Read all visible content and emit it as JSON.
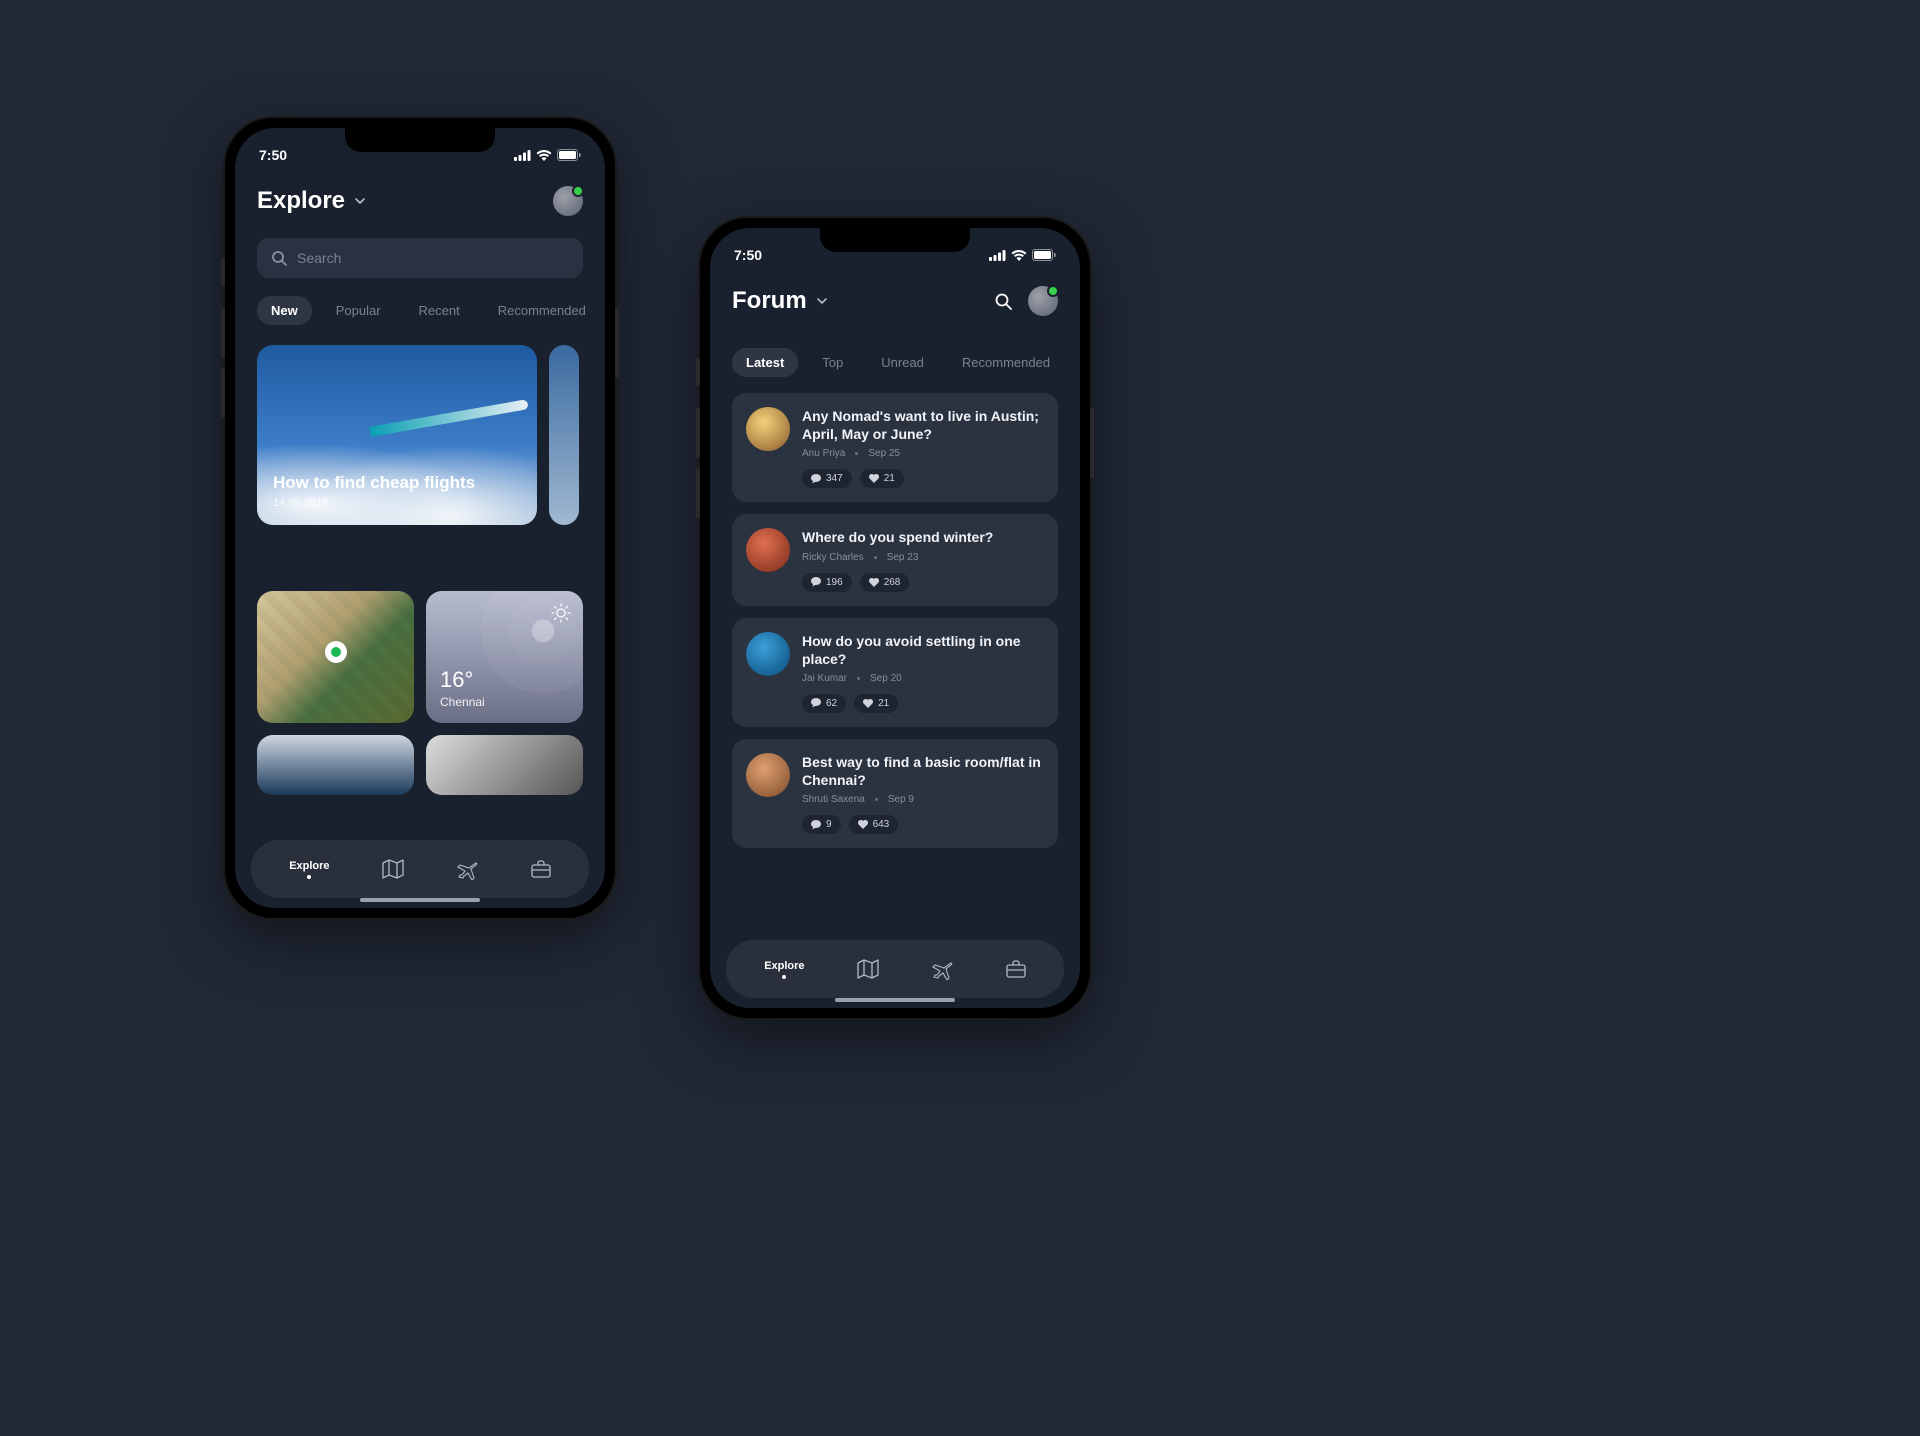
{
  "status": {
    "time": "7:50"
  },
  "explore": {
    "title": "Explore",
    "search_placeholder": "Search",
    "tabs": [
      "New",
      "Popular",
      "Recent",
      "Recommended"
    ],
    "feature": {
      "title": "How to find cheap flights",
      "date": "14.09.2019"
    },
    "weather": {
      "temp": "16°",
      "city": "Chennai"
    }
  },
  "forum": {
    "title": "Forum",
    "tabs": [
      "Latest",
      "Top",
      "Unread",
      "Recommended"
    ],
    "posts": [
      {
        "title": "Any Nomad's want to live in Austin; April, May or June?",
        "author": "Anu Priya",
        "date": "Sep 25",
        "comments": "347",
        "likes": "21"
      },
      {
        "title": "Where do you spend winter?",
        "author": "Ricky Charles",
        "date": "Sep 23",
        "comments": "196",
        "likes": "268"
      },
      {
        "title": "How do you avoid settling in one place?",
        "author": "Jai Kumar",
        "date": "Sep 20",
        "comments": "62",
        "likes": "21"
      },
      {
        "title": "Best way to find a basic room/flat in Chennai?",
        "author": "Shruti Saxena",
        "date": "Sep 9",
        "comments": "9",
        "likes": "643"
      }
    ]
  },
  "nav": {
    "explore": "Explore"
  }
}
